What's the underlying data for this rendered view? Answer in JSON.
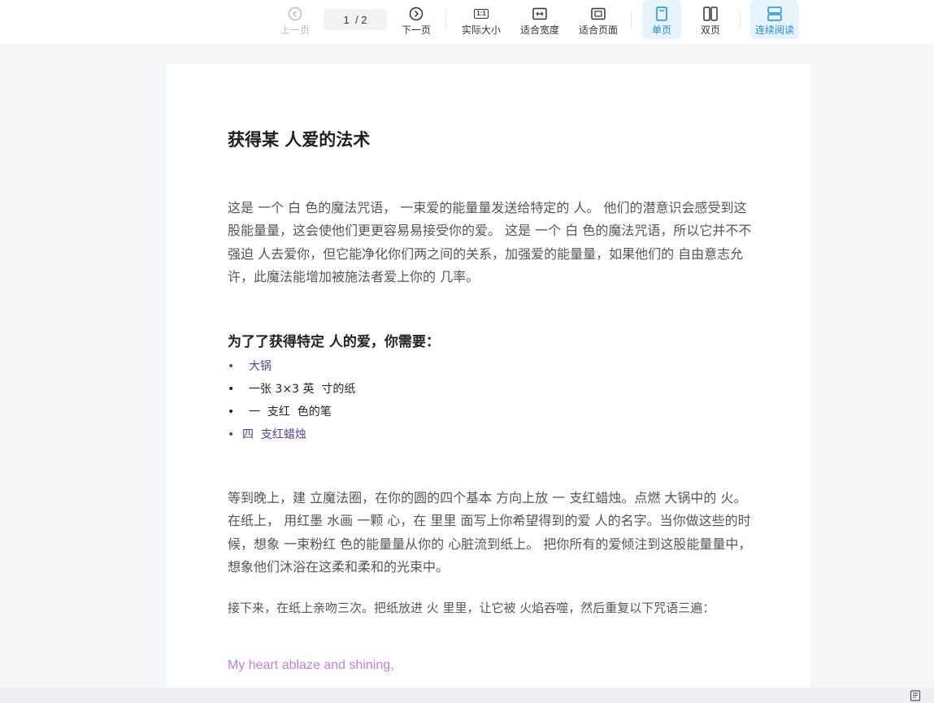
{
  "toolbar": {
    "prev_label": "上一页",
    "page_indicator": "1  / 2",
    "next_label": "下一页",
    "actual_size_label": "实际大小",
    "fit_width_label": "适合宽度",
    "fit_page_label": "适合页面",
    "single_page_label": "单页",
    "double_page_label": "双页",
    "continuous_label": "连续阅读",
    "actual_size_glyph": "1:1",
    "accent_color": "#1a8fd6"
  },
  "document": {
    "title": "获得某 人爱的法术",
    "paragraph1": "这是 一个 白 色的魔法咒语， 一束爱的能量量发送给特定的 人。 他们的潜意识会感受到这股能量量，这会使他们更更容易易接受你的爱。 这是 一个 白 色的魔法咒语，所以它并不不强迫 人去爱你，但它能净化你们两之间的关系，加强爱的能量量，如果他们的 自由意志允许，此魔法能增加被施法者爱上你的 几率。",
    "subheading": "为了了获得特定 人的爱，你需要：",
    "list": [
      {
        "bullet": "•",
        "text": "大锅"
      },
      {
        "bullet": "•",
        "text": "一张 3×3 英  寸的纸"
      },
      {
        "bullet": "•",
        "text": "一  支红  色的笔"
      },
      {
        "bullet": "•",
        "text": "四  支红蜡烛"
      }
    ],
    "paragraph2": "等到晚上，建 立魔法圈，在你的圆的四个基本 方向上放 一 支红蜡烛。点燃 大锅中的 火。在纸上， 用红墨  水画 一颗 心，在 里里 面写上你希望得到的爱 人的名字。当你做这些的时候，想象 一束粉红 色的能量量从你的 心脏流到纸上。 把你所有的爱倾注到这股能量量中，想象他们沐浴在这柔和柔和的光束中。",
    "paragraph3": "接下来，在纸上亲吻三次。把纸放进 火 里里，让它被 火焰吞噬，然后重复以下咒语三遍：",
    "english_line": "My heart ablaze and shining,"
  }
}
